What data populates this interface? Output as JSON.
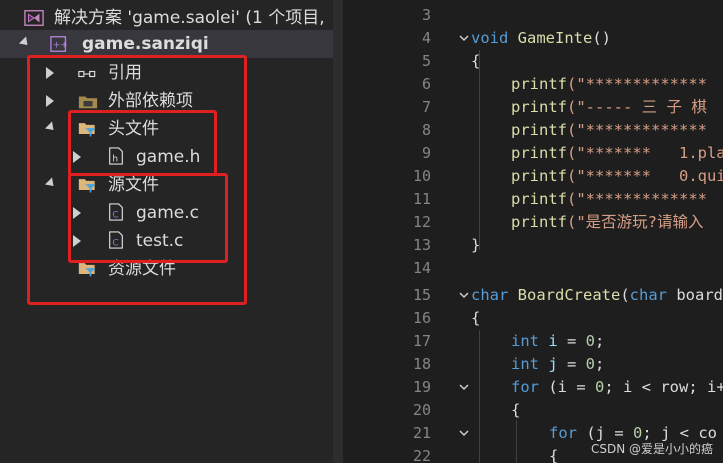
{
  "solution": {
    "title": "解决方案 'game.saolei' (1 个项目,"
  },
  "project": {
    "name": "game.sanziqi"
  },
  "tree": {
    "references": "引用",
    "external_deps": "外部依赖项",
    "header_files": "头文件",
    "header_file_1": "game.h",
    "source_files": "源文件",
    "source_file_1": "game.c",
    "source_file_2": "test.c",
    "resource_files": "资源文件"
  },
  "editor": {
    "line_numbers": [
      "3",
      "4",
      "5",
      "6",
      "7",
      "8",
      "9",
      "10",
      "11",
      "12",
      "13",
      "14",
      "15",
      "16",
      "17",
      "18",
      "19",
      "20",
      "21",
      "22"
    ],
    "lines": {
      "l4_kw": "void",
      "l4_fn": "GameInte",
      "l4_rest": "()",
      "l5": "{",
      "l6_fn": "printf",
      "l6_str": "(\"*************",
      "l7_fn": "printf",
      "l7_str": "(\"----- 三 子 棋",
      "l8_fn": "printf",
      "l8_str": "(\"*************",
      "l9_fn": "printf",
      "l9_str": "(\"*******   1.pla",
      "l10_fn": "printf",
      "l10_str": "(\"*******   0.qui",
      "l11_fn": "printf",
      "l11_str": "(\"*************",
      "l12_fn": "printf",
      "l12_str": "(\"是否游玩?请输入",
      "l13": "}",
      "l15_kw": "char",
      "l15_fn": "BoardCreate",
      "l15_p": "(",
      "l15_kw2": "char",
      "l15_rest": " board",
      "l16": "{",
      "l17_kw": "int",
      "l17_var": " i",
      "l17_op": " = ",
      "l17_num": "0",
      "l17_end": ";",
      "l18_kw": "int",
      "l18_var": " j",
      "l18_op": " = ",
      "l18_num": "0",
      "l18_end": ";",
      "l19_kw": "for",
      "l19_rest": " (i = ",
      "l19_num": "0",
      "l19_rest2": "; i < row; i+",
      "l20": "{",
      "l21_kw": "for",
      "l21_rest": " (j = ",
      "l21_num": "0",
      "l21_rest2": "; j < co",
      "l22": "{"
    }
  },
  "watermark": "CSDN @爱是小小的癌"
}
